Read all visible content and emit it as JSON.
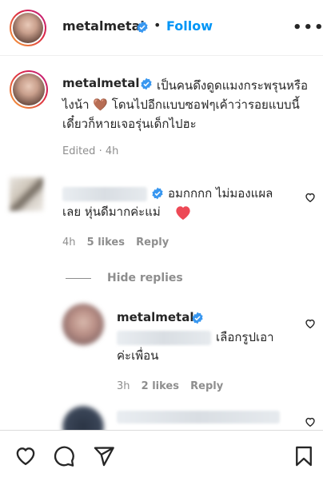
{
  "header": {
    "username": "metalmetal",
    "separator": "•",
    "follow_label": "Follow",
    "more_label": "•••"
  },
  "caption": {
    "username": "metalmetal",
    "text": "เป็นคนดึงดูดแมงกระพรุนหรือไงน้า 🤎 โดนไปอีกแบบซอฟๆเค้าว่ารอยแบบนี้เดี๋ยวก็หายเจอรุ่นเด็กไปฮะ",
    "edited": "Edited",
    "dot": "·",
    "time": "4h"
  },
  "comment1": {
    "text_line1": "อมกกกก ไม่มองแผล",
    "text_line2": "เลย หุ่นดีมากค่ะแม่",
    "time": "4h",
    "likes": "5 likes",
    "reply": "Reply"
  },
  "hide_replies": "Hide replies",
  "reply1": {
    "username": "metalmetal",
    "text_line1": "เลือกรูปเอา",
    "text_line2": "ค่ะเพื่อน",
    "time": "3h",
    "likes": "2 likes",
    "reply": "Reply"
  },
  "colors": {
    "accent": "#0095f6",
    "verified": "#3897f0",
    "muted": "#8e8e8e",
    "heart_red": "#ed4956"
  },
  "icons": [
    "verified-badge-icon",
    "heart-outline-icon",
    "comment-icon",
    "share-icon",
    "bookmark-icon",
    "more-icon"
  ]
}
